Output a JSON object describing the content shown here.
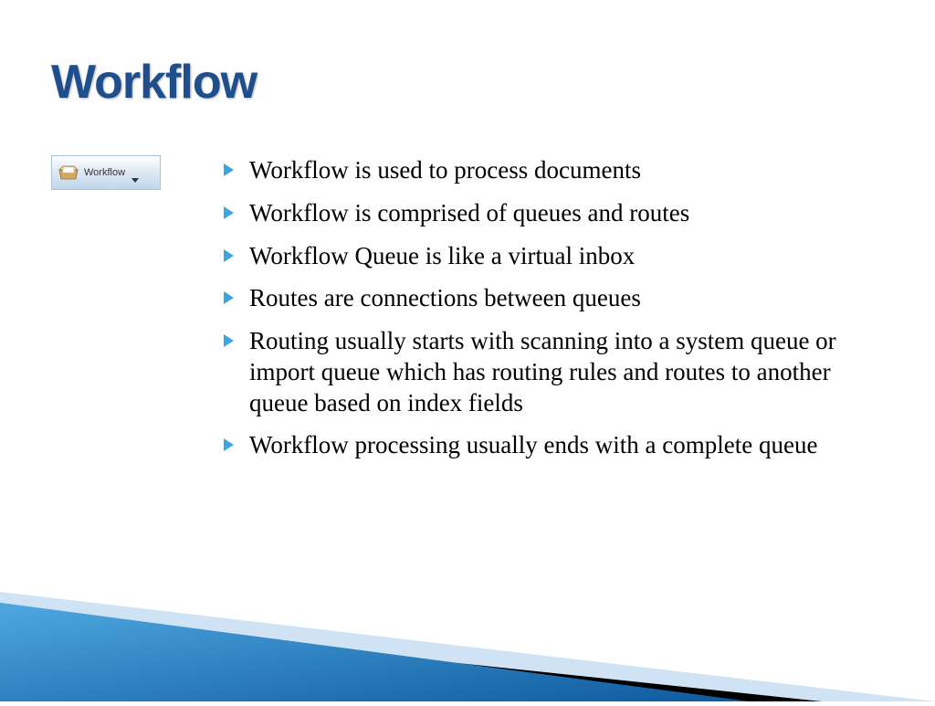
{
  "title": "Workflow",
  "toolbar": {
    "label": "Workflow"
  },
  "bullets": [
    "Workflow is used to process documents",
    "Workflow is comprised of queues and routes",
    "Workflow Queue is like a virtual inbox",
    "Routes are connections between queues",
    "Routing usually starts with scanning into a system queue or import queue which has routing rules and routes to another queue based on index fields",
    "Workflow processing usually ends with a complete queue"
  ]
}
